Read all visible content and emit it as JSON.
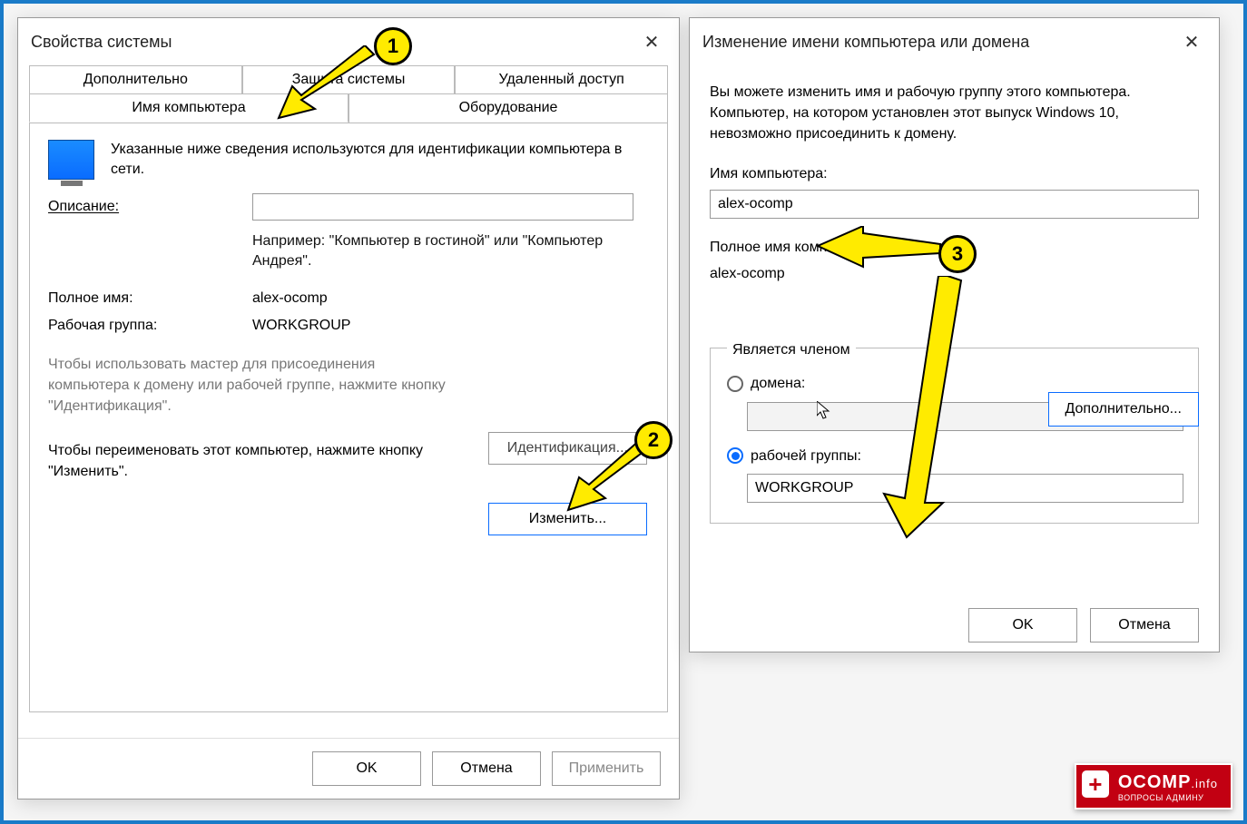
{
  "left": {
    "title": "Свойства системы",
    "tabs_row1": [
      "Дополнительно",
      "Защита системы",
      "Удаленный доступ"
    ],
    "tabs_row2": [
      "Имя компьютера",
      "Оборудование"
    ],
    "active_tab": "Имя компьютера",
    "info": "Указанные ниже сведения используются для идентификации компьютера в сети.",
    "desc_label": "Описание:",
    "desc_value": "",
    "desc_hint": "Например: \"Компьютер в гостиной\" или \"Компьютер Андрея\".",
    "fullname_label": "Полное имя:",
    "fullname_value": "alex-ocomp",
    "workgroup_label": "Рабочая группа:",
    "workgroup_value": "WORKGROUP",
    "wizard_text": "Чтобы использовать мастер для присоединения компьютера к домену или рабочей группе, нажмите кнопку \"Идентификация\".",
    "identify_btn": "Идентификация...",
    "rename_text": "Чтобы переименовать этот компьютер, нажмите кнопку \"Изменить\".",
    "change_btn": "Изменить...",
    "ok": "OK",
    "cancel": "Отмена",
    "apply": "Применить"
  },
  "right": {
    "title": "Изменение имени компьютера или домена",
    "intro": "Вы можете изменить имя и рабочую группу этого компьютера. Компьютер, на котором установлен этот выпуск Windows 10, невозможно присоединить к домену.",
    "name_label": "Имя компьютера:",
    "name_value": "alex-ocomp",
    "fullname_label": "Полное имя компьютера:",
    "fullname_value": "alex-ocomp",
    "more_btn": "Дополнительно...",
    "member_legend": "Является членом",
    "domain_label": "домена:",
    "domain_value": "",
    "workgroup_label": "рабочей группы:",
    "workgroup_value": "WORKGROUP",
    "ok": "OK",
    "cancel": "Отмена"
  },
  "badges": {
    "b1": "1",
    "b2": "2",
    "b3": "3"
  },
  "watermark": {
    "brand": "OCOMP",
    "suffix": ".info",
    "sub": "ВОПРОСЫ АДМИНУ"
  }
}
